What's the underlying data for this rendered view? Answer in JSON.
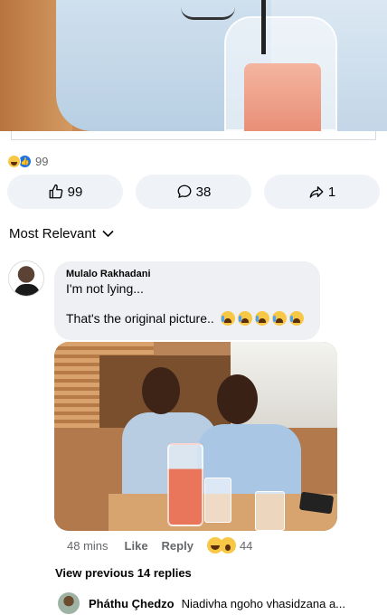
{
  "post": {
    "reactions_count": "99",
    "actions": {
      "like_count": "99",
      "comment_count": "38",
      "share_count": "1"
    }
  },
  "comments_sort": {
    "label": "Most Relevant"
  },
  "comment": {
    "author": "Mulalo Rakhadani",
    "line1": "I'm not lying...",
    "line2": "That's the original picture..",
    "time": "48 mins",
    "like_label": "Like",
    "reply_label": "Reply",
    "reaction_count": "44"
  },
  "view_previous": "View previous 14 replies",
  "reply": {
    "author": "Pháthu Çhedzo",
    "text": "Niadivha ngoho vhasidzana a..."
  }
}
